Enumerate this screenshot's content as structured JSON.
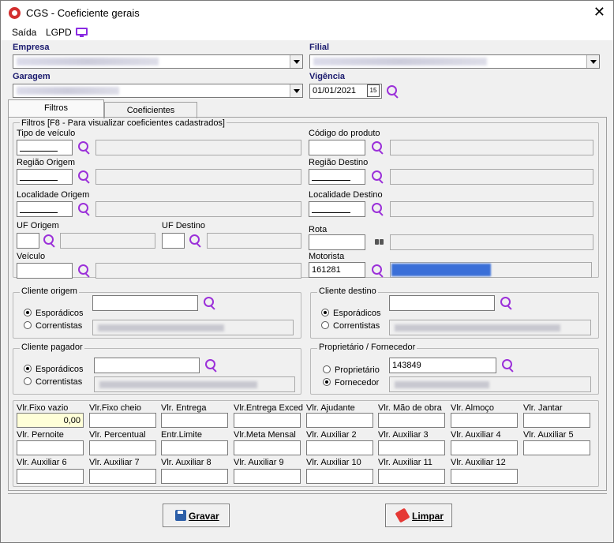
{
  "window": {
    "title": "CGS - Coeficiente gerais",
    "close": "✕"
  },
  "menu": {
    "exit": "Saída",
    "lgpd": "LGPD"
  },
  "header": {
    "empresa_label": "Empresa",
    "filial_label": "Filial",
    "garagem_label": "Garagem",
    "vigencia_label": "Vigência",
    "vigencia_value": "01/01/2021",
    "calendar_glyph": "15"
  },
  "tabs": {
    "filtros": "Filtros",
    "coeficientes": "Coeficientes"
  },
  "filters": {
    "group_title": "Filtros [F8 - Para visualizar coeficientes cadastrados]",
    "tipo_veiculo": "Tipo de veículo",
    "codigo_produto": "Código do produto",
    "regiao_origem": "Região Origem",
    "regiao_destino": "Região Destino",
    "localidade_origem": "Localidade Origem",
    "localidade_destino": "Localidade Destino",
    "uf_origem": "UF Origem",
    "uf_destino": "UF Destino",
    "rota": "Rota",
    "veiculo": "Veículo",
    "motorista": "Motorista",
    "motorista_value": "161281"
  },
  "cliente_origem": {
    "title": "Cliente origem",
    "esporadicos": "Esporádicos",
    "correntistas": "Correntistas"
  },
  "cliente_destino": {
    "title": "Cliente destino",
    "esporadicos": "Esporádicos",
    "correntistas": "Correntistas"
  },
  "cliente_pagador": {
    "title": "Cliente pagador",
    "esporadicos": "Esporádicos",
    "correntistas": "Correntistas"
  },
  "proprietario": {
    "title": "Proprietário / Fornecedor",
    "proprietario": "Proprietário",
    "fornecedor": "Fornecedor",
    "value": "143849"
  },
  "values": {
    "row1": [
      "Vlr.Fixo vazio",
      "Vlr.Fixo cheio",
      "Vlr. Entrega",
      "Vlr.Entrega Exced",
      "Vlr. Ajudante",
      "Vlr. Mão de obra",
      "Vlr. Almoço",
      "Vlr. Jantar"
    ],
    "row2": [
      "Vlr. Pernoite",
      "Vlr. Percentual",
      "Entr.Limite",
      "Vlr.Meta Mensal",
      "Vlr. Auxiliar 2",
      "Vlr. Auxiliar 3",
      "Vlr. Auxiliar 4",
      "Vlr. Auxiliar 5"
    ],
    "row3": [
      "Vlr. Auxiliar 6",
      "Vlr. Auxiliar 7",
      "Vlr. Auxiliar 8",
      "Vlr. Auxiliar 9",
      "Vlr. Auxiliar 10",
      "Vlr. Auxiliar 11",
      "Vlr. Auxiliar 12"
    ],
    "fixo_vazio_value": "0,00"
  },
  "buttons": {
    "save": "Gravar",
    "clear": "Limpar"
  }
}
